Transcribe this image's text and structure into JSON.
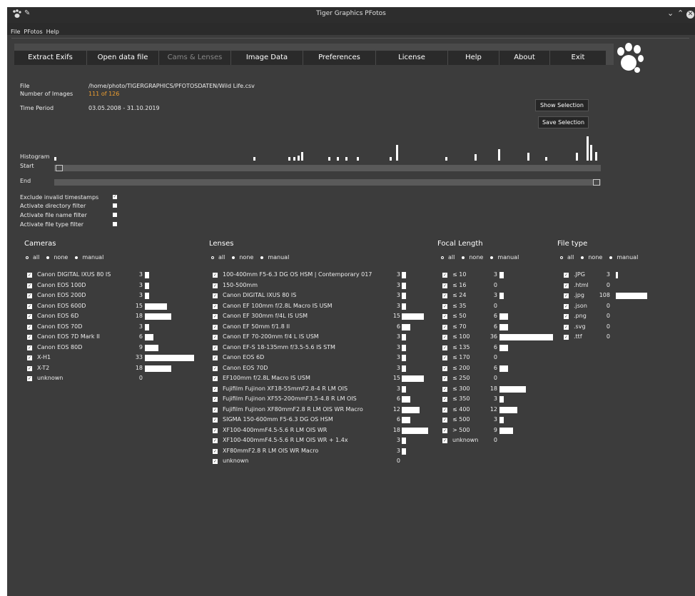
{
  "window": {
    "title": "Tiger Graphics PFotos"
  },
  "menu": [
    "File",
    "PFotos",
    "Help"
  ],
  "toolbar": [
    "Extract Exifs",
    "Open data file",
    "Cams & Lenses",
    "Image Data",
    "Preferences",
    "License",
    "Help",
    "About",
    "Exit"
  ],
  "info": {
    "file_label": "File",
    "file_value": "/home/photo/TIGERGRAPHICS/PFOTOSDATEN/Wild Life.csv",
    "num_label": "Number of Images",
    "num_value": "111 of 126",
    "period_label": "Time Period",
    "period_value": "03.05.2008 - 31.10.2019"
  },
  "buttons": {
    "show": "Show Selection",
    "save": "Save Selection"
  },
  "histogram": {
    "label": "Histogram",
    "start": "Start",
    "end": "End"
  },
  "filters": [
    {
      "label": "Exclude invalid timestamps",
      "checked": true
    },
    {
      "label": "Activate directory filter",
      "checked": false
    },
    {
      "label": "Activate file name filter",
      "checked": false
    },
    {
      "label": "Activate file type filter",
      "checked": false
    }
  ],
  "radio": {
    "all": "all",
    "none": "none",
    "manual": "manual"
  },
  "cameras": {
    "title": "Cameras",
    "items": [
      {
        "name": "Canon DIGITAL IXUS 80 IS",
        "count": "3",
        "v": 3
      },
      {
        "name": "Canon EOS 100D",
        "count": "3",
        "v": 3
      },
      {
        "name": "Canon EOS 200D",
        "count": "3",
        "v": 3
      },
      {
        "name": "Canon EOS 600D",
        "count": "15",
        "v": 15
      },
      {
        "name": "Canon EOS 6D",
        "count": "18",
        "v": 18
      },
      {
        "name": "Canon EOS 70D",
        "count": "3",
        "v": 3
      },
      {
        "name": "Canon EOS 7D Mark II",
        "count": "6",
        "v": 6
      },
      {
        "name": "Canon EOS 80D",
        "count": "9",
        "v": 9
      },
      {
        "name": "X-H1",
        "count": "33",
        "v": 33
      },
      {
        "name": "X-T2",
        "count": "18",
        "v": 18
      },
      {
        "name": "unknown",
        "count": "0",
        "v": 0
      }
    ]
  },
  "lenses": {
    "title": "Lenses",
    "items": [
      {
        "name": "100-400mm F5-6.3 DG OS HSM | Contemporary 017",
        "count": "3",
        "v": 3
      },
      {
        "name": "150-500mm",
        "count": "3",
        "v": 3
      },
      {
        "name": "Canon DIGITAL IXUS 80 IS",
        "count": "3",
        "v": 3
      },
      {
        "name": "Canon EF 100mm f/2.8L Macro IS USM",
        "count": "3",
        "v": 3
      },
      {
        "name": "Canon EF 300mm f/4L IS USM",
        "count": "15",
        "v": 15
      },
      {
        "name": "Canon EF 50mm f/1.8 II",
        "count": "6",
        "v": 6
      },
      {
        "name": "Canon EF 70-200mm f/4 L IS USM",
        "count": "3",
        "v": 3
      },
      {
        "name": "Canon EF-S 18-135mm f/3.5-5.6 IS STM",
        "count": "3",
        "v": 3
      },
      {
        "name": "Canon EOS 6D",
        "count": "3",
        "v": 3
      },
      {
        "name": "Canon EOS 70D",
        "count": "3",
        "v": 3
      },
      {
        "name": "EF100mm f/2.8L Macro IS USM",
        "count": "15",
        "v": 15
      },
      {
        "name": "Fujifilm Fujinon XF18-55mmF2.8-4 R LM OIS",
        "count": "3",
        "v": 3
      },
      {
        "name": "Fujifilm Fujinon XF55-200mmF3.5-4.8 R LM OIS",
        "count": "6",
        "v": 6
      },
      {
        "name": "Fujifilm Fujinon XF80mmF2.8 R LM OIS WR Macro",
        "count": "12",
        "v": 12
      },
      {
        "name": "SIGMA 150-600mm F5-6.3 DG OS HSM",
        "count": "6",
        "v": 6
      },
      {
        "name": "XF100-400mmF4.5-5.6 R LM OIS WR",
        "count": "18",
        "v": 18
      },
      {
        "name": "XF100-400mmF4.5-5.6 R LM OIS WR + 1.4x",
        "count": "3",
        "v": 3
      },
      {
        "name": "XF80mmF2.8 R LM OIS WR Macro",
        "count": "3",
        "v": 3
      },
      {
        "name": "unknown",
        "count": "0",
        "v": 0
      }
    ]
  },
  "focal": {
    "title": "Focal Length",
    "items": [
      {
        "name": "≤ 10",
        "count": "3",
        "v": 3
      },
      {
        "name": "≤ 16",
        "count": "0",
        "v": 0
      },
      {
        "name": "≤ 24",
        "count": "3",
        "v": 3
      },
      {
        "name": "≤ 35",
        "count": "0",
        "v": 0
      },
      {
        "name": "≤ 50",
        "count": "6",
        "v": 6
      },
      {
        "name": "≤ 70",
        "count": "6",
        "v": 6
      },
      {
        "name": "≤ 100",
        "count": "36",
        "v": 36
      },
      {
        "name": "≤ 135",
        "count": "6",
        "v": 6
      },
      {
        "name": "≤ 170",
        "count": "0",
        "v": 0
      },
      {
        "name": "≤ 200",
        "count": "6",
        "v": 6
      },
      {
        "name": "≤ 250",
        "count": "0",
        "v": 0
      },
      {
        "name": "≤ 300",
        "count": "18",
        "v": 18
      },
      {
        "name": "≤ 350",
        "count": "3",
        "v": 3
      },
      {
        "name": "≤ 400",
        "count": "12",
        "v": 12
      },
      {
        "name": "≤ 500",
        "count": "3",
        "v": 3
      },
      {
        "name": "> 500",
        "count": "9",
        "v": 9
      },
      {
        "name": "unknown",
        "count": "0",
        "v": 0
      }
    ]
  },
  "filetype": {
    "title": "File type",
    "items": [
      {
        "name": ".JPG",
        "count": "3",
        "v": 3
      },
      {
        "name": ".html",
        "count": "0",
        "v": 0
      },
      {
        "name": ".jpg",
        "count": "108",
        "v": 108
      },
      {
        "name": ".json",
        "count": "0",
        "v": 0
      },
      {
        "name": ".png",
        "count": "0",
        "v": 0
      },
      {
        "name": ".svg",
        "count": "0",
        "v": 0
      },
      {
        "name": ".ttf",
        "count": "0",
        "v": 0
      }
    ]
  }
}
